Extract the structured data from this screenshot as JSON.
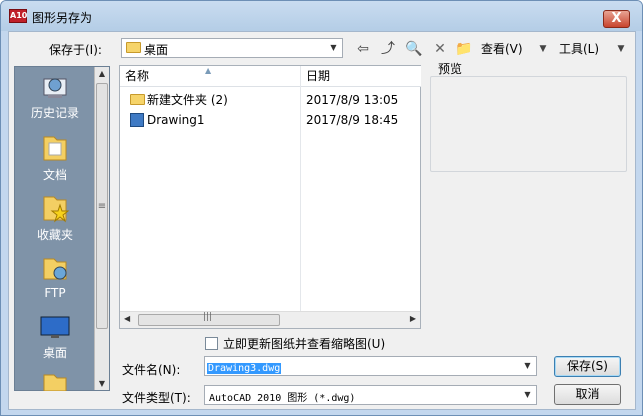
{
  "window": {
    "title": "图形另存为",
    "app_icon_text": "A10",
    "close_label": "X"
  },
  "toolbar": {
    "save_in_label": "保存于(I):",
    "save_in_value": "桌面",
    "view_label": "查看(V)",
    "tools_label": "工具(L)"
  },
  "places": [
    {
      "label": "历史记录",
      "icon": "history-icon"
    },
    {
      "label": "文档",
      "icon": "documents-icon"
    },
    {
      "label": "收藏夹",
      "icon": "favorites-icon"
    },
    {
      "label": "FTP",
      "icon": "ftp-icon"
    },
    {
      "label": "桌面",
      "icon": "desktop-icon"
    }
  ],
  "filelist": {
    "col_name": "名称",
    "col_date": "日期",
    "rows": [
      {
        "name": "新建文件夹 (2)",
        "date": "2017/8/9 13:05",
        "icon": "folder-icon"
      },
      {
        "name": "Drawing1",
        "date": "2017/8/9 18:45",
        "icon": "dwg-file-icon"
      }
    ]
  },
  "preview": {
    "label": "预览"
  },
  "update_thumbnail": {
    "label": "立即更新图纸并查看缩略图(U)",
    "checked": false
  },
  "filename": {
    "label": "文件名(N):",
    "value": "Drawing3.dwg"
  },
  "filetype": {
    "label": "文件类型(T):",
    "value": "AutoCAD 2010 图形 (*.dwg)"
  },
  "buttons": {
    "save": "保存(S)",
    "cancel": "取消"
  }
}
